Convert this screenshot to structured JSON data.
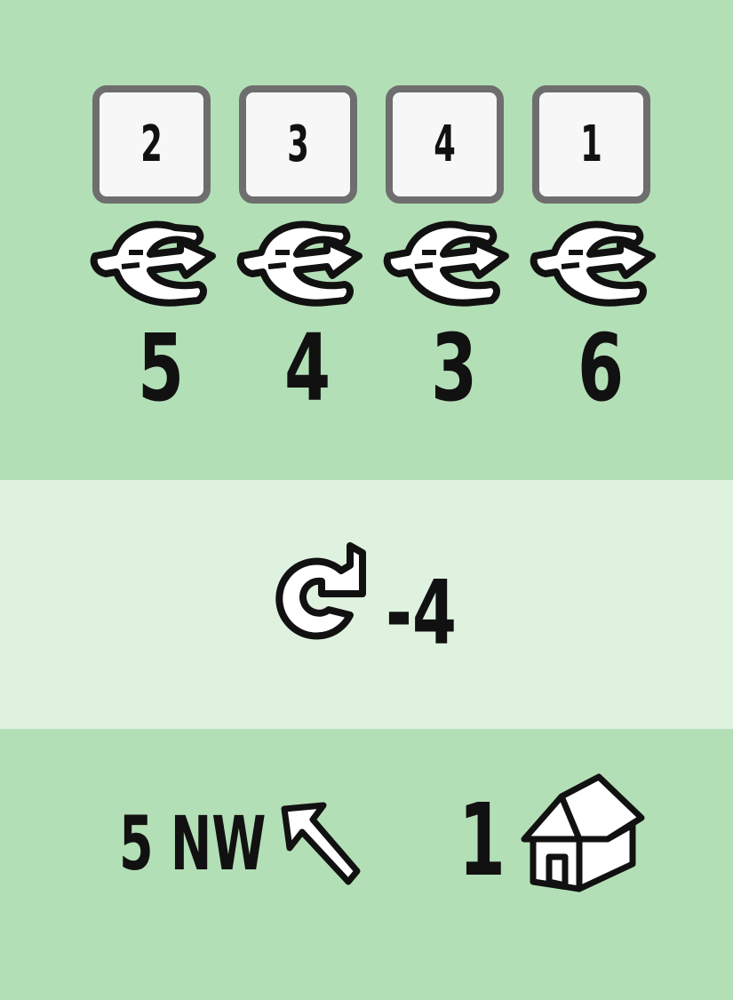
{
  "slots": [
    "2",
    "3",
    "4",
    "1"
  ],
  "costs": [
    "5",
    "4",
    "3",
    "6"
  ],
  "icons": {
    "cost": "energy-symbol-icon",
    "middle": "refresh-icon",
    "direction": "arrow-nw-icon",
    "building": "house-icon"
  },
  "refresh_value": "-4",
  "move_label": "5 NW",
  "house_count": "1",
  "colors": {
    "background": "#b3dfb6",
    "middle_band": "#dff2e0",
    "slot_border": "#6e6e6e",
    "ink": "#111111"
  }
}
